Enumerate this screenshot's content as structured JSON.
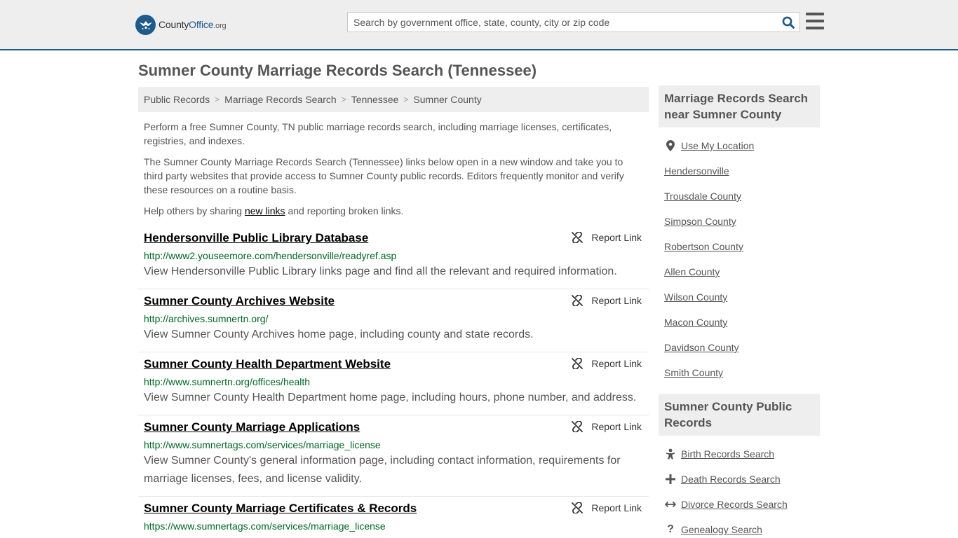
{
  "header": {
    "logo_county": "County",
    "logo_office": "Office",
    "logo_tld": ".org",
    "search_placeholder": "Search by government office, state, county, city or zip code",
    "search_icon": "magnifier-icon",
    "menu_icon": "hamburger-icon"
  },
  "page": {
    "title": "Sumner County Marriage Records Search (Tennessee)"
  },
  "breadcrumb": [
    "Public Records",
    "Marriage Records Search",
    "Tennessee",
    "Sumner County"
  ],
  "intro": {
    "p1": "Perform a free Sumner County, TN public marriage records search, including marriage licenses, certificates, registries, and indexes.",
    "p2": "The Sumner County Marriage Records Search (Tennessee) links below open in a new window and take you to third party websites that provide access to Sumner County public records. Editors frequently monitor and verify these resources on a routine basis.",
    "p3_before": "Help others by sharing ",
    "p3_link": "new links",
    "p3_after": " and reporting broken links."
  },
  "report_label": "Report Link",
  "results": [
    {
      "title": "Hendersonville Public Library Database",
      "url": "http://www2.youseemore.com/hendersonville/readyref.asp",
      "desc": "View Hendersonville Public Library links page and find all the relevant and required information."
    },
    {
      "title": "Sumner County Archives Website",
      "url": "http://archives.sumnertn.org/",
      "desc": "View Sumner County Archives home page, including county and state records."
    },
    {
      "title": "Sumner County Health Department Website",
      "url": "http://www.sumnertn.org/offices/health",
      "desc": "View Sumner County Health Department home page, including hours, phone number, and address."
    },
    {
      "title": "Sumner County Marriage Applications",
      "url": "http://www.sumnertags.com/services/marriage_license",
      "desc": "View Sumner County's general information page, including contact information, requirements for marriage licenses, fees, and license validity."
    },
    {
      "title": "Sumner County Marriage Certificates & Records",
      "url": "https://www.sumnertags.com/services/marriage_license",
      "desc": ""
    }
  ],
  "sidebar": {
    "nearby_title": "Marriage Records Search near Sumner County",
    "use_location": "Use My Location",
    "nearby": [
      "Hendersonville",
      "Trousdale County",
      "Simpson County",
      "Robertson County",
      "Allen County",
      "Wilson County",
      "Macon County",
      "Davidson County",
      "Smith County"
    ],
    "public_title": "Sumner County Public Records",
    "public": [
      {
        "label": "Birth Records Search",
        "icon": "baby-icon"
      },
      {
        "label": "Death Records Search",
        "icon": "cross-icon"
      },
      {
        "label": "Divorce Records Search",
        "icon": "arrows-horizontal-icon"
      },
      {
        "label": "Genealogy Search",
        "icon": "question-icon"
      }
    ]
  }
}
